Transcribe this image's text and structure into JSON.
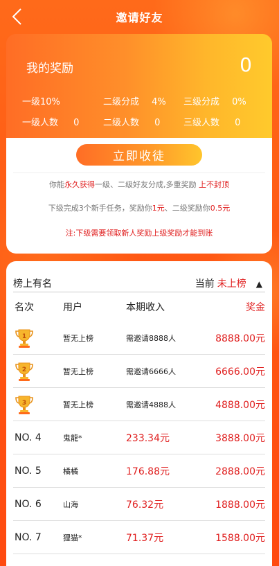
{
  "header": {
    "title": "邀请好友"
  },
  "reward": {
    "title": "我的奖励",
    "value": "0",
    "stats": [
      {
        "label": "一级10%",
        "value": ""
      },
      {
        "label": "二级分成",
        "value": "4%"
      },
      {
        "label": "三级分成",
        "value": "0%"
      },
      {
        "label": "一级人数",
        "value": "0"
      },
      {
        "label": "二级人数",
        "value": "0"
      },
      {
        "label": "三级人数",
        "value": "0"
      }
    ]
  },
  "invite": {
    "button_label": "立即收徒",
    "line1": {
      "a": "你能",
      "b": "永久获得",
      "c": "一级、二级好友分成,多重奖励",
      "d": "上不封顶"
    },
    "line2": {
      "a": "下级完成3个新手任务，奖励你",
      "b": "1元",
      "c": "、二级奖励你",
      "d": "0.5元"
    },
    "note": "注:下级需要领取新人奖励上级奖励才能到账"
  },
  "ranking": {
    "title": "榜上有名",
    "current_label": "当前",
    "current_value": "未上榜",
    "columns": {
      "rank": "名次",
      "user": "用户",
      "income": "本期收入",
      "bonus": "奖金"
    },
    "rows": [
      {
        "rank": "1",
        "user": "暂无上榜",
        "income": "需邀请8888人",
        "bonus": "8888.00元",
        "trophy": true
      },
      {
        "rank": "2",
        "user": "暂无上榜",
        "income": "需邀请6666人",
        "bonus": "6666.00元",
        "trophy": true
      },
      {
        "rank": "3",
        "user": "暂无上榜",
        "income": "需邀请4888人",
        "bonus": "4888.00元",
        "trophy": true
      },
      {
        "rank": "NO. 4",
        "user": "鬼龍*",
        "income": "233.34元",
        "bonus": "3888.00元",
        "trophy": false
      },
      {
        "rank": "NO. 5",
        "user": "橘橘",
        "income": "176.88元",
        "bonus": "2888.00元",
        "trophy": false
      },
      {
        "rank": "NO. 6",
        "user": "山海",
        "income": "76.32元",
        "bonus": "1888.00元",
        "trophy": false
      },
      {
        "rank": "NO. 7",
        "user": "狸猫*",
        "income": "71.37元",
        "bonus": "1588.00元",
        "trophy": false
      }
    ]
  },
  "colors": {
    "accent": "#ff6a1a",
    "gold": "#ffc52c",
    "red_text": "#e02020"
  }
}
